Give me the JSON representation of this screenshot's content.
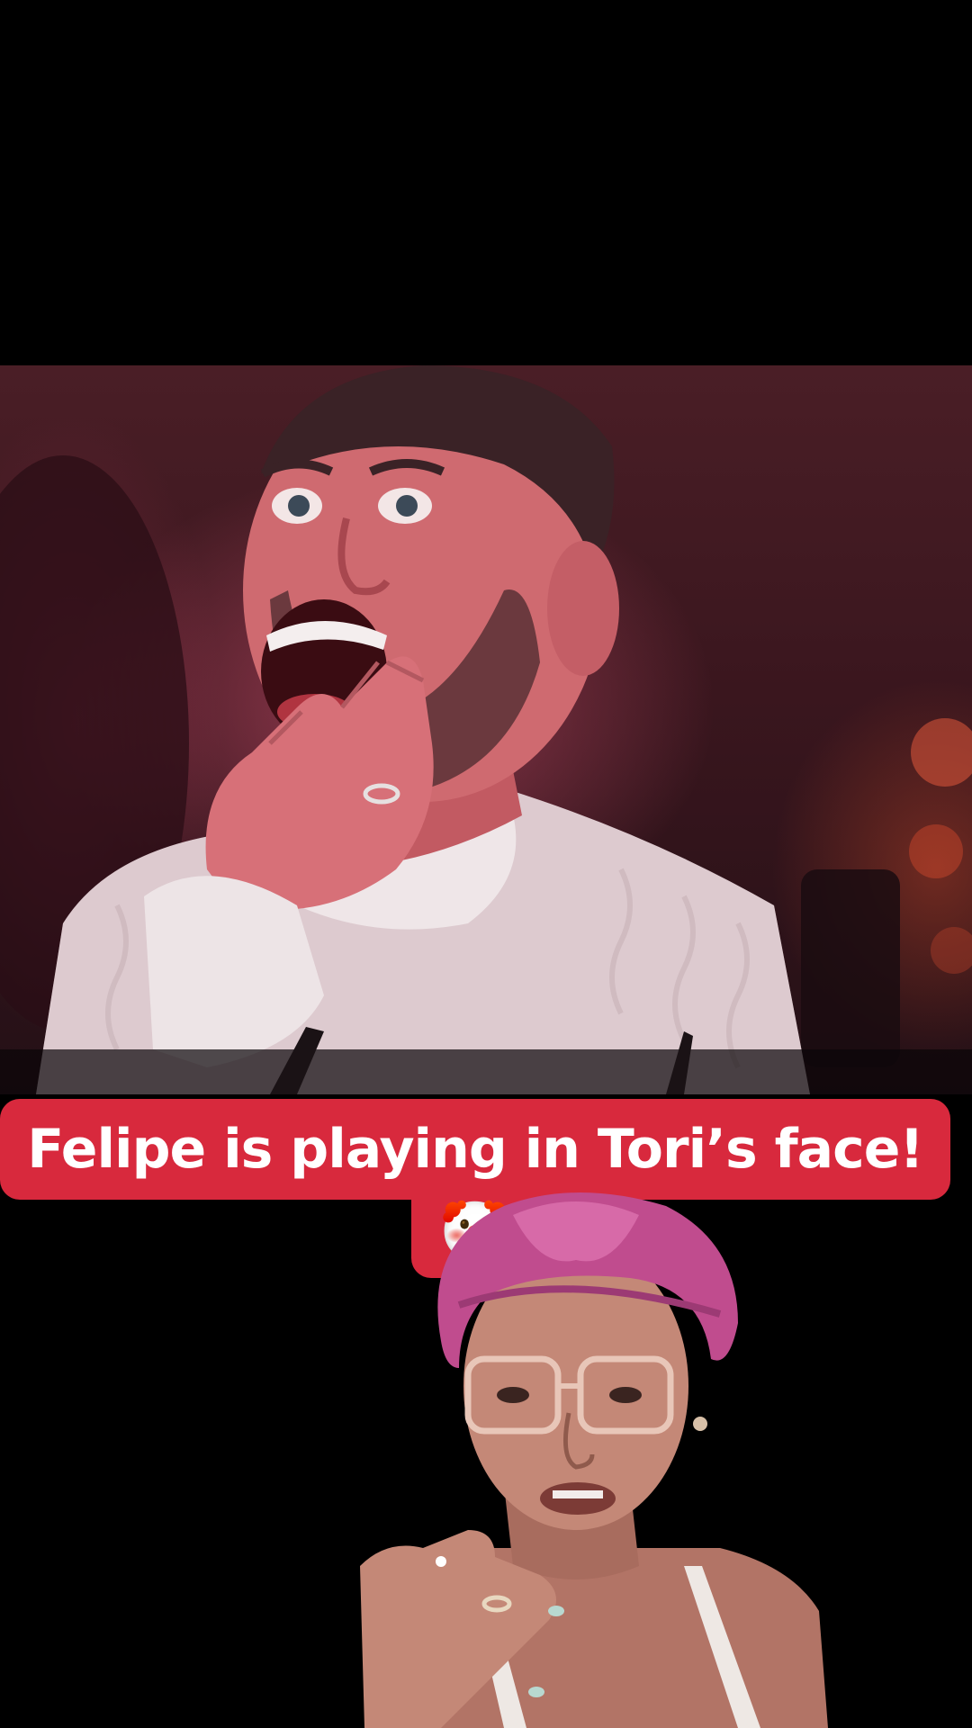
{
  "caption": {
    "text": "Felipe is playing in Tori’s face!",
    "emoji": "🤡",
    "emoji_name": "clown-face-emoji"
  },
  "colors": {
    "caption_background": "#d8293d",
    "caption_text": "#ffffff",
    "page_background": "#000000"
  },
  "scene": {
    "video_subject": "shocked man in cream cable-knit sweater",
    "creator_subject": "woman in pink satin bonnet and clear glasses"
  }
}
